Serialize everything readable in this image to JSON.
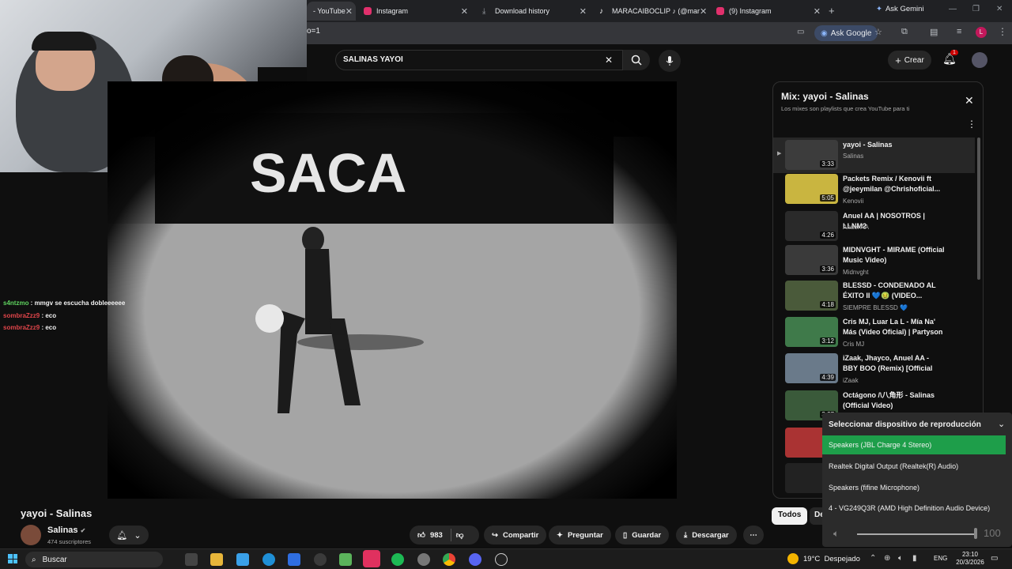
{
  "browser": {
    "tabs": [
      {
        "label": "- YouTube",
        "icon": "youtube-icon",
        "color": "#ff0000"
      },
      {
        "label": "Instagram",
        "icon": "instagram-icon",
        "color": "#e1306c"
      },
      {
        "label": "Download history",
        "icon": "download-icon",
        "color": "#9aa0a6"
      },
      {
        "label": "MARACAIBOCLIP ♪ (@mar",
        "icon": "tiktok-icon",
        "color": "#ffffff"
      },
      {
        "label": "(9) Instagram",
        "icon": "instagram-icon",
        "color": "#e1306c"
      }
    ],
    "ask_gemini": "Ask Gemini",
    "url": "o=1",
    "ask_google": "Ask Google",
    "profile_initial": "L"
  },
  "youtube": {
    "search_value": "SALINAS YAYOI",
    "create_label": "Crear",
    "notification_count": "1",
    "video_title": "yayoi - Salinas",
    "channel_name": "Salinas",
    "subscribers": "474 suscriptores",
    "likes": "983",
    "actions": {
      "share": "Compartir",
      "ask": "Preguntar",
      "save": "Guardar",
      "download": "Descargar"
    },
    "filter_all": "Todos",
    "filter_partial": "De"
  },
  "chat": [
    {
      "user": "s4ntzmo",
      "message": " : mmgv se escucha dobleeeeee",
      "color": "#5fd35f"
    },
    {
      "user": "sombraZzz9",
      "message": " : eco",
      "color": "#e0454a"
    },
    {
      "user": "sombraZzz9",
      "message": " : eco",
      "color": "#e0454a"
    }
  ],
  "playlist": {
    "title": "Mix: yayoi - Salinas",
    "subtitle": "Los mixes son playlists que crea YouTube para ti",
    "items": [
      {
        "title": "yayoi - Salinas",
        "channel": "Salinas",
        "duration": "3:33",
        "thumb": "#444"
      },
      {
        "title": "Packets Remix / Kenovii ft @jeeymilan @Chrishoficial...",
        "channel": "Kenovii",
        "duration": "5:05",
        "thumb": "#c9b540"
      },
      {
        "title": "Anuel AA | NOSOTROS | LLNM2",
        "channel": "Anuel AA",
        "duration": "4:26",
        "thumb": "#2a2a2a"
      },
      {
        "title": "MIDNVGHT - MIRAME (Official Music Video)",
        "channel": "Midnvght",
        "duration": "3:36",
        "thumb": "#3a3a3a"
      },
      {
        "title": "BLESSD - CONDENADO AL ÉXITO II 💙🤢 (VIDEO...",
        "channel": "SIEMPRE BLESSD 💙",
        "duration": "4:18",
        "thumb": "#4a5a3a"
      },
      {
        "title": "Cris MJ, Luar La L - Mía Na' Más (Video Oficial) | Partyson",
        "channel": "Cris MJ",
        "duration": "3:12",
        "thumb": "#3f7a4a"
      },
      {
        "title": "iZaak, Jhayco, Anuel AA - BBY BOO (Remix) [Official Video]",
        "channel": "iZaak",
        "duration": "4:39",
        "thumb": "#6a7a8a"
      },
      {
        "title": "Octágono /\\八角形 - Salinas (Official Video)",
        "channel": "",
        "duration": "3:37",
        "thumb": "#3a5a3a"
      }
    ]
  },
  "devices": {
    "title": "Seleccionar dispositivo de reproducción",
    "options": [
      {
        "label": "Speakers (JBL Charge 4 Stereo)",
        "selected": true
      },
      {
        "label": "Realtek Digital Output (Realtek(R) Audio)",
        "selected": false
      },
      {
        "label": "Speakers (fifine Microphone)",
        "selected": false
      },
      {
        "label": "4 - VG249Q3R (AMD High Definition Audio Device)",
        "selected": false
      }
    ],
    "volume": "100",
    "volume_level": 1.0
  },
  "taskbar": {
    "search_label": "Buscar",
    "weather": "19°C  Despejado",
    "language": "ENG",
    "time": "23:10",
    "date": "20/3/2026"
  },
  "colors": {
    "accent_green": "#1db954",
    "device_selected": "#1e9e4a",
    "youtube_red": "#ff0000"
  }
}
